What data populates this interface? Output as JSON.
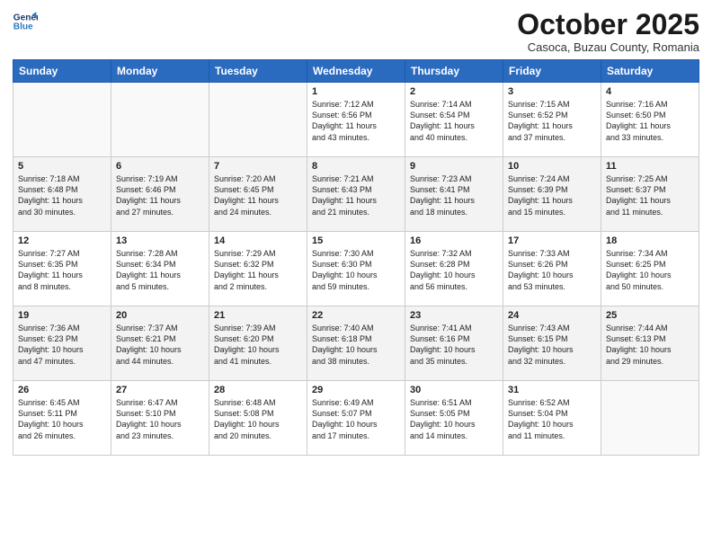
{
  "logo": {
    "line1": "General",
    "line2": "Blue"
  },
  "title": "October 2025",
  "subtitle": "Casoca, Buzau County, Romania",
  "weekdays": [
    "Sunday",
    "Monday",
    "Tuesday",
    "Wednesday",
    "Thursday",
    "Friday",
    "Saturday"
  ],
  "weeks": [
    [
      {
        "num": "",
        "info": ""
      },
      {
        "num": "",
        "info": ""
      },
      {
        "num": "",
        "info": ""
      },
      {
        "num": "1",
        "info": "Sunrise: 7:12 AM\nSunset: 6:56 PM\nDaylight: 11 hours\nand 43 minutes."
      },
      {
        "num": "2",
        "info": "Sunrise: 7:14 AM\nSunset: 6:54 PM\nDaylight: 11 hours\nand 40 minutes."
      },
      {
        "num": "3",
        "info": "Sunrise: 7:15 AM\nSunset: 6:52 PM\nDaylight: 11 hours\nand 37 minutes."
      },
      {
        "num": "4",
        "info": "Sunrise: 7:16 AM\nSunset: 6:50 PM\nDaylight: 11 hours\nand 33 minutes."
      }
    ],
    [
      {
        "num": "5",
        "info": "Sunrise: 7:18 AM\nSunset: 6:48 PM\nDaylight: 11 hours\nand 30 minutes."
      },
      {
        "num": "6",
        "info": "Sunrise: 7:19 AM\nSunset: 6:46 PM\nDaylight: 11 hours\nand 27 minutes."
      },
      {
        "num": "7",
        "info": "Sunrise: 7:20 AM\nSunset: 6:45 PM\nDaylight: 11 hours\nand 24 minutes."
      },
      {
        "num": "8",
        "info": "Sunrise: 7:21 AM\nSunset: 6:43 PM\nDaylight: 11 hours\nand 21 minutes."
      },
      {
        "num": "9",
        "info": "Sunrise: 7:23 AM\nSunset: 6:41 PM\nDaylight: 11 hours\nand 18 minutes."
      },
      {
        "num": "10",
        "info": "Sunrise: 7:24 AM\nSunset: 6:39 PM\nDaylight: 11 hours\nand 15 minutes."
      },
      {
        "num": "11",
        "info": "Sunrise: 7:25 AM\nSunset: 6:37 PM\nDaylight: 11 hours\nand 11 minutes."
      }
    ],
    [
      {
        "num": "12",
        "info": "Sunrise: 7:27 AM\nSunset: 6:35 PM\nDaylight: 11 hours\nand 8 minutes."
      },
      {
        "num": "13",
        "info": "Sunrise: 7:28 AM\nSunset: 6:34 PM\nDaylight: 11 hours\nand 5 minutes."
      },
      {
        "num": "14",
        "info": "Sunrise: 7:29 AM\nSunset: 6:32 PM\nDaylight: 11 hours\nand 2 minutes."
      },
      {
        "num": "15",
        "info": "Sunrise: 7:30 AM\nSunset: 6:30 PM\nDaylight: 10 hours\nand 59 minutes."
      },
      {
        "num": "16",
        "info": "Sunrise: 7:32 AM\nSunset: 6:28 PM\nDaylight: 10 hours\nand 56 minutes."
      },
      {
        "num": "17",
        "info": "Sunrise: 7:33 AM\nSunset: 6:26 PM\nDaylight: 10 hours\nand 53 minutes."
      },
      {
        "num": "18",
        "info": "Sunrise: 7:34 AM\nSunset: 6:25 PM\nDaylight: 10 hours\nand 50 minutes."
      }
    ],
    [
      {
        "num": "19",
        "info": "Sunrise: 7:36 AM\nSunset: 6:23 PM\nDaylight: 10 hours\nand 47 minutes."
      },
      {
        "num": "20",
        "info": "Sunrise: 7:37 AM\nSunset: 6:21 PM\nDaylight: 10 hours\nand 44 minutes."
      },
      {
        "num": "21",
        "info": "Sunrise: 7:39 AM\nSunset: 6:20 PM\nDaylight: 10 hours\nand 41 minutes."
      },
      {
        "num": "22",
        "info": "Sunrise: 7:40 AM\nSunset: 6:18 PM\nDaylight: 10 hours\nand 38 minutes."
      },
      {
        "num": "23",
        "info": "Sunrise: 7:41 AM\nSunset: 6:16 PM\nDaylight: 10 hours\nand 35 minutes."
      },
      {
        "num": "24",
        "info": "Sunrise: 7:43 AM\nSunset: 6:15 PM\nDaylight: 10 hours\nand 32 minutes."
      },
      {
        "num": "25",
        "info": "Sunrise: 7:44 AM\nSunset: 6:13 PM\nDaylight: 10 hours\nand 29 minutes."
      }
    ],
    [
      {
        "num": "26",
        "info": "Sunrise: 6:45 AM\nSunset: 5:11 PM\nDaylight: 10 hours\nand 26 minutes."
      },
      {
        "num": "27",
        "info": "Sunrise: 6:47 AM\nSunset: 5:10 PM\nDaylight: 10 hours\nand 23 minutes."
      },
      {
        "num": "28",
        "info": "Sunrise: 6:48 AM\nSunset: 5:08 PM\nDaylight: 10 hours\nand 20 minutes."
      },
      {
        "num": "29",
        "info": "Sunrise: 6:49 AM\nSunset: 5:07 PM\nDaylight: 10 hours\nand 17 minutes."
      },
      {
        "num": "30",
        "info": "Sunrise: 6:51 AM\nSunset: 5:05 PM\nDaylight: 10 hours\nand 14 minutes."
      },
      {
        "num": "31",
        "info": "Sunrise: 6:52 AM\nSunset: 5:04 PM\nDaylight: 10 hours\nand 11 minutes."
      },
      {
        "num": "",
        "info": ""
      }
    ]
  ]
}
